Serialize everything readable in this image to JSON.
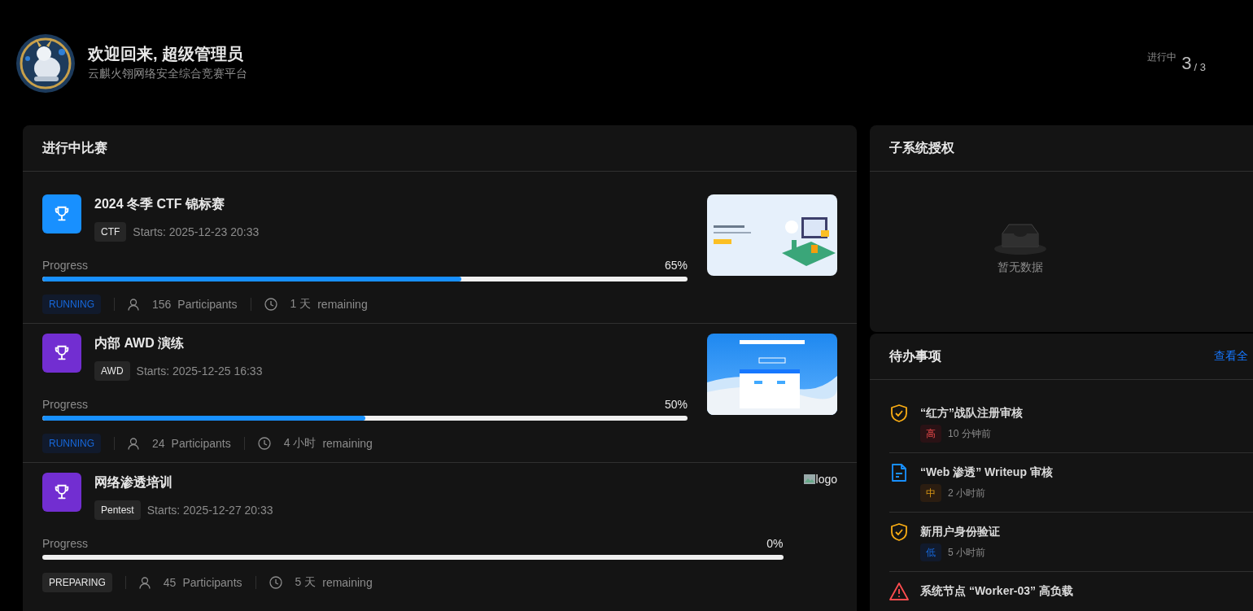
{
  "header": {
    "greeting": "欢迎回来, 超级管理员",
    "subtitle": "云麒火翎网络安全综合竞赛平台",
    "stats": [
      {
        "label": "进行中",
        "value": "3",
        "total": "/ 3"
      }
    ]
  },
  "competitions": {
    "title": "进行中比赛",
    "items": [
      {
        "color": "#1890ff",
        "title": "2024 冬季 CTF 锦标赛",
        "tag": "CTF",
        "starts": "Starts: 2025-12-23 20:33",
        "progress_label": "Progress",
        "percent": "65%",
        "level": 0.65,
        "status": "RUNNING",
        "kind": "running",
        "participants": "156",
        "participants_label": "Participants",
        "remaining": "1 天",
        "remaining_label": "remaining"
      },
      {
        "color": "#722ed1",
        "title": "内部 AWD 演练",
        "tag": "AWD",
        "starts": "Starts: 2025-12-25 16:33",
        "progress_label": "Progress",
        "percent": "50%",
        "level": 0.5,
        "status": "RUNNING",
        "kind": "running",
        "participants": "24",
        "participants_label": "Participants",
        "remaining": "4 小时",
        "remaining_label": "remaining"
      },
      {
        "color": "#722ed1",
        "title": "网络渗透培训",
        "tag": "Pentest",
        "starts": "Starts: 2025-12-27 20:33",
        "progress_label": "Progress",
        "percent": "0%",
        "level": 0,
        "status": "PREPARING",
        "kind": "preparing",
        "participants": "45",
        "participants_label": "Participants",
        "remaining": "5 天",
        "remaining_label": "remaining",
        "media": {
          "kind": "broken",
          "alt": "logo"
        }
      }
    ]
  },
  "subsystems": {
    "title": "子系统授权",
    "empty_text": "暂无数据"
  },
  "todos": {
    "title": "待办事项",
    "link": "查看全",
    "items": [
      {
        "kind": "shield",
        "title": "“红方”战队注册审核",
        "priority": {
          "text": "高",
          "kind": "high"
        },
        "time": "10 分钟前"
      },
      {
        "kind": "document",
        "title": "“Web 渗透” Writeup 审核",
        "priority": {
          "text": "中",
          "kind": "medium"
        },
        "time": "2 小时前"
      },
      {
        "kind": "shield",
        "title": "新用户身份验证",
        "priority": {
          "text": "低",
          "kind": "low"
        },
        "time": "5 小时前"
      },
      {
        "kind": "warning",
        "title": "系统节点 “Worker-03” 高负载"
      }
    ]
  }
}
